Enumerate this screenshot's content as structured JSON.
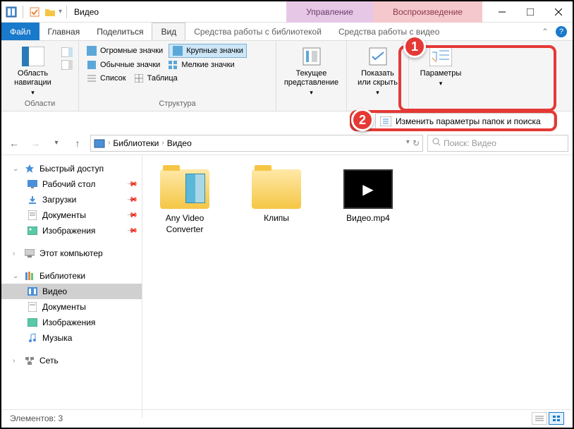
{
  "title": "Видео",
  "context_tabs": {
    "manage": "Управление",
    "playback": "Воспроизведение"
  },
  "ribbon_tabs": {
    "file": "Файл",
    "home": "Главная",
    "share": "Поделиться",
    "view": "Вид",
    "sub1": "Средства работы с библиотекой",
    "sub2": "Средства работы с видео"
  },
  "ribbon": {
    "nav_pane": "Область навигации",
    "group_panes": "Области",
    "icons": {
      "huge": "Огромные значки",
      "large": "Крупные значки",
      "normal": "Обычные значки",
      "small": "Мелкие значки",
      "list": "Список",
      "table": "Таблица"
    },
    "group_layout": "Структура",
    "current_view": "Текущее представление",
    "show_hide": "Показать или скрыть",
    "options": "Параметры",
    "change_options": "Изменить параметры папок и поиска"
  },
  "callouts": {
    "one": "1",
    "two": "2"
  },
  "breadcrumb": {
    "libs": "Библиотеки",
    "video": "Видео"
  },
  "search_placeholder": "Поиск: Видео",
  "sidebar": {
    "quick": "Быстрый доступ",
    "desktop": "Рабочий стол",
    "downloads": "Загрузки",
    "documents": "Документы",
    "pictures": "Изображения",
    "thispc": "Этот компьютер",
    "libraries": "Библиотеки",
    "video": "Видео",
    "documents2": "Документы",
    "pictures2": "Изображения",
    "music": "Музыка",
    "network": "Сеть"
  },
  "files": {
    "f1": "Any Video Converter",
    "f2": "Клипы",
    "f3": "Видео.mp4"
  },
  "status": "Элементов: 3"
}
